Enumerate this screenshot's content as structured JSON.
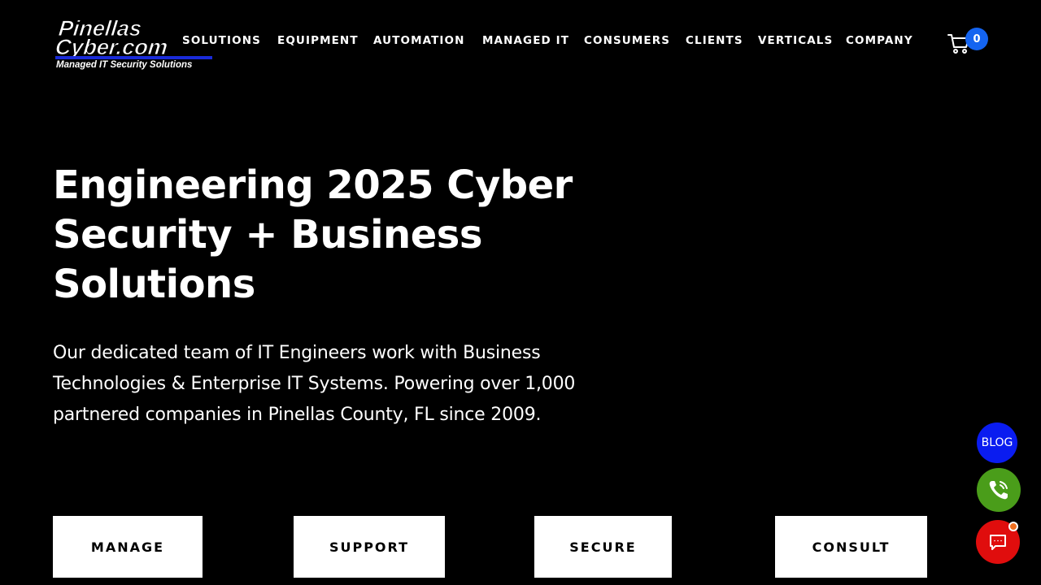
{
  "logo": {
    "line1": "Pinellas",
    "line2": "Cyber.com",
    "tagline": "Managed IT Security Solutions"
  },
  "nav": {
    "items": [
      {
        "label": "SOLUTIONS"
      },
      {
        "label": "EQUIPMENT"
      },
      {
        "label": "AUTOMATION"
      },
      {
        "label": "MANAGED IT"
      },
      {
        "label": "CONSUMERS"
      },
      {
        "label": "CLIENTS"
      },
      {
        "label": "VERTICALS"
      },
      {
        "label": "COMPANY"
      }
    ]
  },
  "cart": {
    "icon": "cart-icon",
    "count": "0",
    "badge_color": "#1464f0"
  },
  "hero": {
    "title": "Engineering 2025 Cyber Security + Business Solutions",
    "text": "Our dedicated team of IT Engineers work with Business Technologies & Enterprise IT Systems. Powering over 1,000 partnered companies in Pinellas County, FL since 2009."
  },
  "cta_buttons": [
    {
      "label": "MANAGE"
    },
    {
      "label": "SUPPORT"
    },
    {
      "label": "SECURE"
    },
    {
      "label": "CONSULT"
    }
  ],
  "floating": {
    "blog_label": "BLOG",
    "blog_color": "#0a1cf0",
    "phone_icon": "phone-icon",
    "phone_color": "#4a9d1a",
    "chat_icon": "chat-icon",
    "chat_color": "#e00d0d"
  }
}
